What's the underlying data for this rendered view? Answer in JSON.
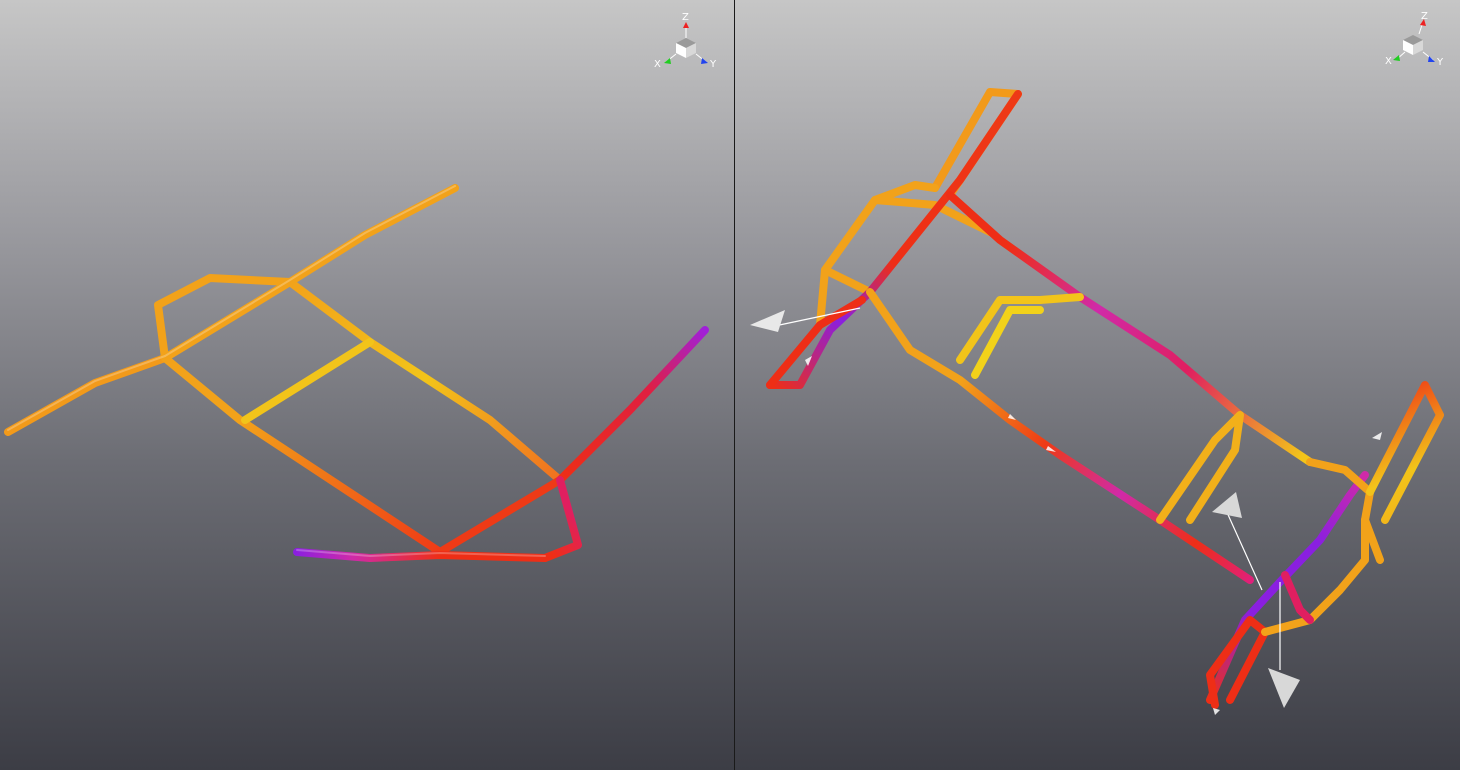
{
  "viewports": [
    {
      "id": "left",
      "axes": {
        "x_label": "X",
        "y_label": "Y",
        "z_label": "Z"
      }
    },
    {
      "id": "right",
      "axes": {
        "x_label": "X",
        "y_label": "Y",
        "z_label": "Z"
      }
    }
  ],
  "colors": {
    "orange": "#f2a21a",
    "yellow": "#f2d21a",
    "red": "#ee2e16",
    "magenta": "#d02aa8",
    "violet": "#8a1fe0",
    "axis_x": "#22cc22",
    "axis_y": "#2244ee",
    "axis_z": "#ee2222"
  },
  "icons": {
    "axis_triad": "axis-triad-icon",
    "force_arrow": "force-arrow-icon"
  }
}
